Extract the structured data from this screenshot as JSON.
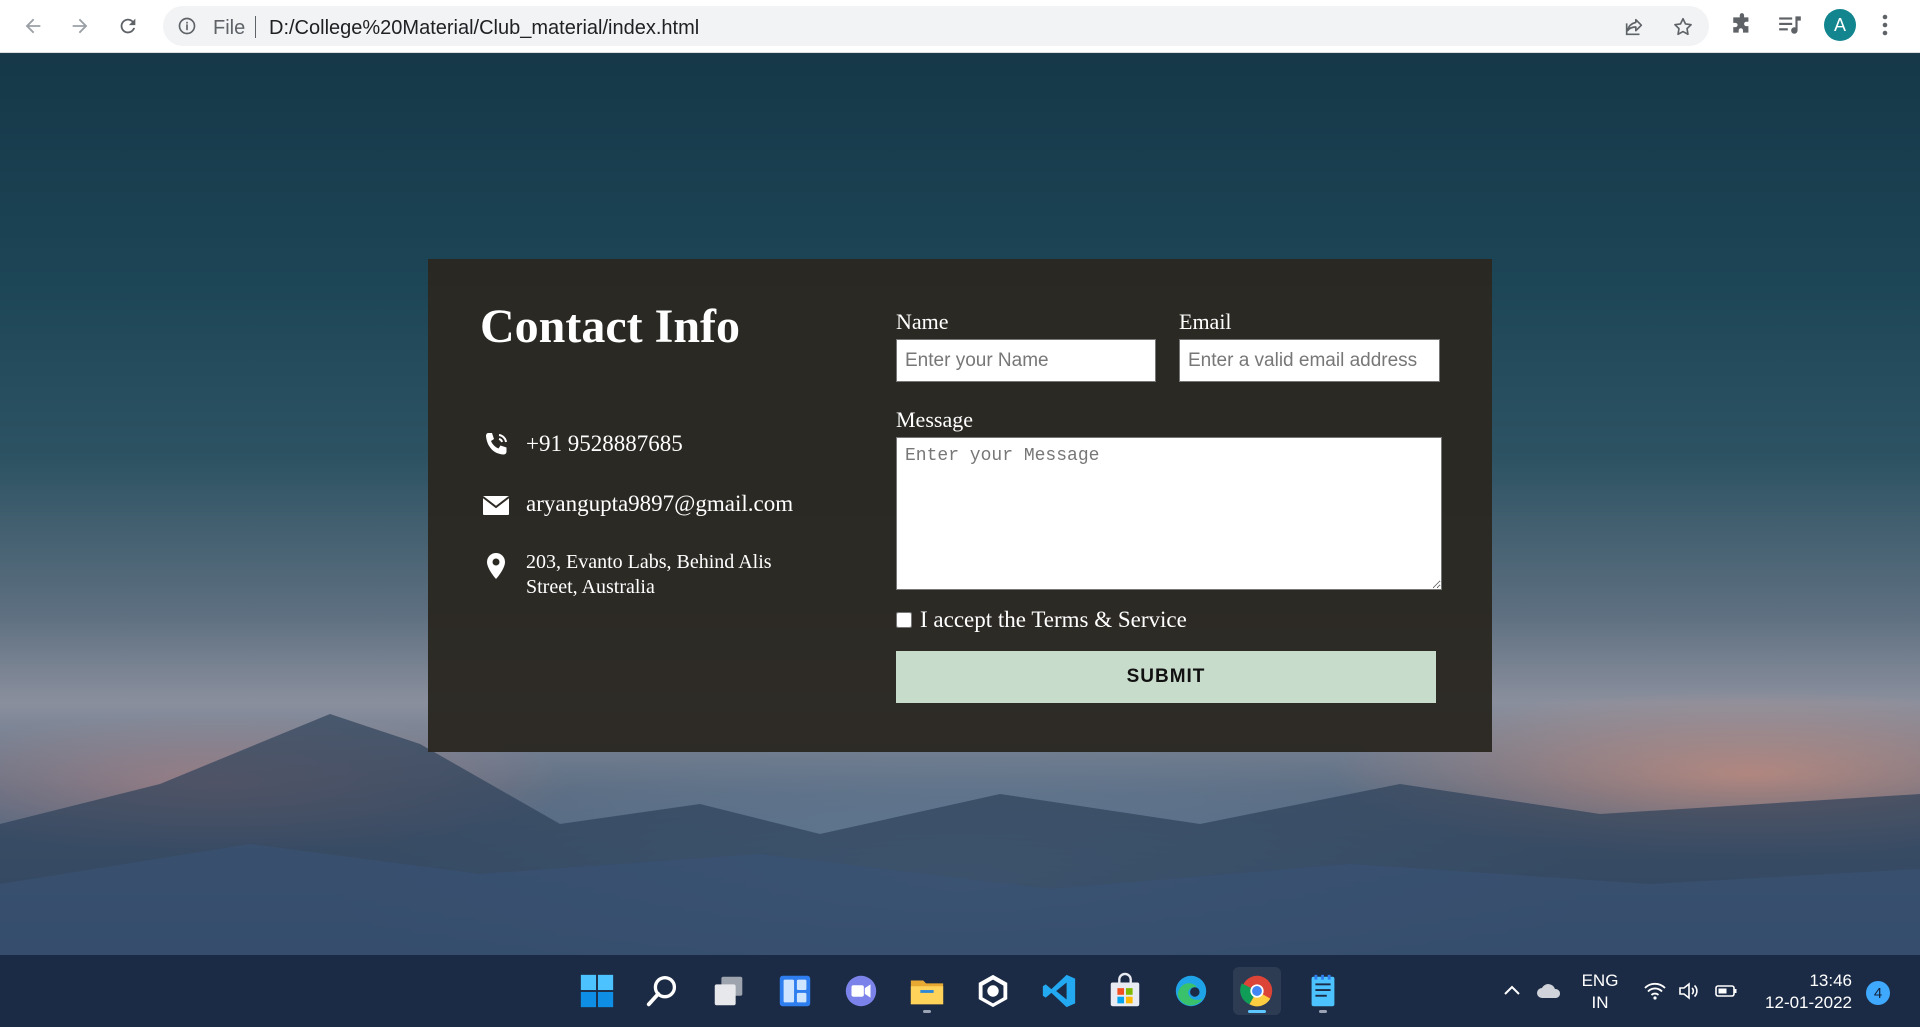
{
  "browser": {
    "scheme_label": "File",
    "url": "D:/College%20Material/Club_material/index.html",
    "profile_initial": "A",
    "icons": [
      "back-icon",
      "forward-icon",
      "reload-icon",
      "info-icon",
      "share-icon",
      "star-icon",
      "extensions-icon",
      "media-icon",
      "kebab-menu-icon"
    ]
  },
  "contact": {
    "title": "Contact Info",
    "phone": "+91 9528887685",
    "email": "aryangupta9897@gmail.com",
    "address_line1": "203, Evanto Labs, Behind Alis",
    "address_line2": "Street, Australia"
  },
  "form": {
    "name_label": "Name",
    "name_placeholder": "Enter your Name",
    "email_label": "Email",
    "email_placeholder": "Enter a valid email address",
    "message_label": "Message",
    "message_placeholder": "Enter your Message",
    "terms_label": "I accept the Terms & Service",
    "terms_checked": false,
    "submit_label": "SUBMIT",
    "submit_color": "#c8dccb"
  },
  "taskbar": {
    "apps": [
      "start-icon",
      "search-icon",
      "task-view-icon",
      "widgets-icon",
      "teams-chat-icon",
      "file-explorer-icon",
      "github-desktop-icon",
      "vscode-icon",
      "store-icon",
      "edge-icon",
      "chrome-icon",
      "notepad-icon"
    ],
    "active_app": "chrome-icon",
    "lang_line1": "ENG",
    "lang_line2": "IN",
    "time": "13:46",
    "date": "12-01-2022",
    "notification_count": "4"
  }
}
